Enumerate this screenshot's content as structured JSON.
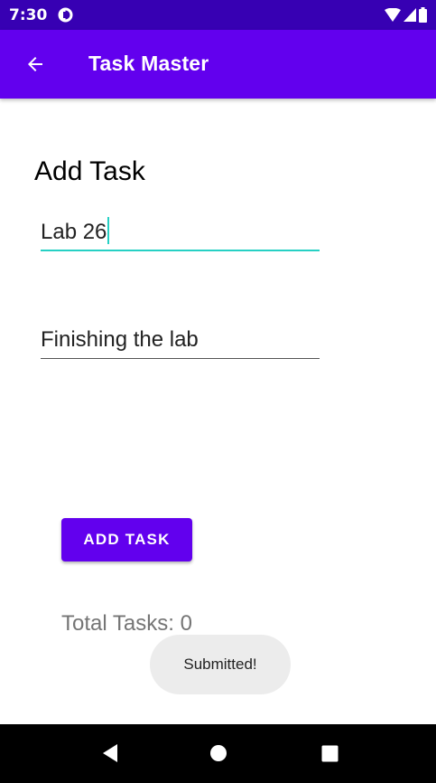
{
  "status_bar": {
    "time": "7:30",
    "icons": [
      "app-notification-icon",
      "wifi-icon",
      "cellular-signal-icon",
      "battery-icon"
    ]
  },
  "app_bar": {
    "title": "Task Master",
    "back_icon": "arrow-back-icon",
    "color": "#6200ee"
  },
  "form": {
    "heading": "Add Task",
    "title_field": {
      "value": "Lab 26"
    },
    "description_field": {
      "value": "Finishing the lab"
    },
    "add_button_label": "ADD TASK"
  },
  "total_tasks_text": "Total Tasks: 0",
  "toast": {
    "message": "Submitted!"
  },
  "nav_bar": {
    "icons": [
      "nav-back-icon",
      "nav-home-icon",
      "nav-recents-icon"
    ]
  },
  "colors": {
    "primary": "#6200ee",
    "status_bar": "#3700b3",
    "accent": "#26d0c4"
  }
}
